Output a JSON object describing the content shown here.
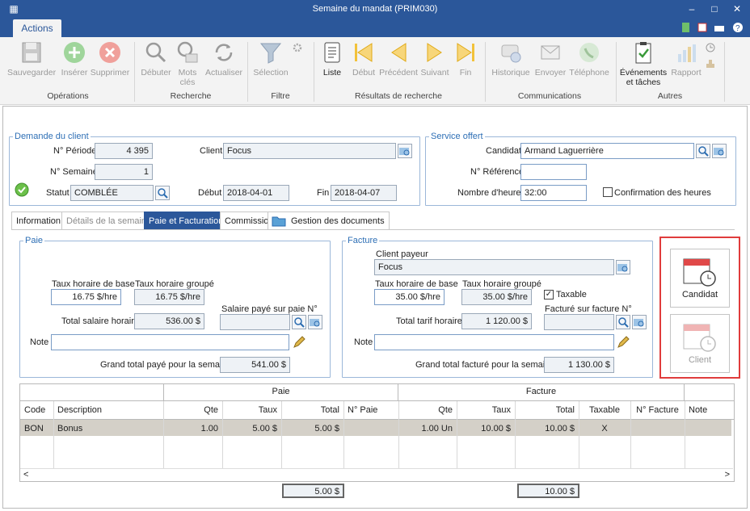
{
  "window": {
    "title": "Semaine du mandat (PRIM030)"
  },
  "ribbon": {
    "tab": "Actions",
    "groups": {
      "operations": {
        "label": "Opérations",
        "save": "Sauvegarder",
        "insert": "Insérer",
        "delete": "Supprimer"
      },
      "search": {
        "label": "Recherche",
        "start": "Débuter",
        "keywords_1": "Mots",
        "keywords_2": "clés",
        "refresh": "Actualiser"
      },
      "filter": {
        "label": "Filtre",
        "selection": "Sélection"
      },
      "results": {
        "label": "Résultats de recherche",
        "list": "Liste",
        "first": "Début",
        "previous": "Précédent",
        "next": "Suivant",
        "last": "Fin"
      },
      "communications": {
        "label": "Communications",
        "history": "Historique",
        "send": "Envoyer",
        "phone": "Téléphone"
      },
      "others": {
        "label": "Autres",
        "events_1": "Événements",
        "events_2": "et tâches",
        "report": "Rapport"
      }
    }
  },
  "client_request": {
    "legend": "Demande du client",
    "period_label": "N° Période",
    "period": "4 395",
    "week_label": "N° Semaine",
    "week": "1",
    "status_label": "Statut",
    "status": "COMBLÉE",
    "client_label": "Client",
    "client": "Focus",
    "start_label": "Début",
    "start": "2018-04-01",
    "end_label": "Fin",
    "end": "2018-04-07"
  },
  "service": {
    "legend": "Service offert",
    "candidate_label": "Candidat",
    "candidate": "Armand Laguerrière",
    "reference_label": "N° Référence",
    "reference": "",
    "hours_label": "Nombre d'heures",
    "hours": "32:00",
    "confirm_label": "Confirmation des heures"
  },
  "tabs": [
    "Information",
    "Détails de la semaine",
    "Paie et Facturation",
    "Commission",
    "Gestion des documents"
  ],
  "pay": {
    "legend": "Paie",
    "base_rate_label": "Taux horaire de base",
    "base_rate": "16.75 $/hre",
    "group_rate_label": "Taux horaire groupé",
    "group_rate": "16.75 $/hre",
    "total_label": "Total salaire horaire",
    "total": "536.00 $",
    "paid_on_label": "Salaire payé sur paie N°",
    "paid_on": "",
    "note_label": "Note",
    "note": "",
    "grand_total_label": "Grand total payé pour la semaine",
    "grand_total": "541.00 $"
  },
  "invoice": {
    "legend": "Facture",
    "payer_label": "Client payeur",
    "payer": "Focus",
    "base_rate_label": "Taux horaire de base",
    "base_rate": "35.00 $/hre",
    "group_rate_label": "Taux horaire groupé",
    "group_rate": "35.00 $/hre",
    "taxable_label": "Taxable",
    "total_label": "Total tarif horaire",
    "total": "1 120.00 $",
    "billed_on_label": "Facturé sur facture N°",
    "billed_on": "",
    "note_label": "Note",
    "note": "",
    "grand_total_label": "Grand total facturé pour la semaine",
    "grand_total": "1 130.00 $"
  },
  "side_tiles": {
    "candidate": "Candidat",
    "client": "Client",
    "highlight_color": "#e03c3c"
  },
  "table": {
    "group_pay": "Paie",
    "group_invoice": "Facture",
    "columns": [
      "Code",
      "Description",
      "Qte",
      "Taux",
      "Total",
      "N° Paie",
      "Qte",
      "Taux",
      "Total",
      "Taxable",
      "N° Facture",
      "Note"
    ],
    "rows": [
      [
        "BON",
        "Bonus",
        "1.00",
        "5.00 $",
        "5.00 $",
        "",
        "1.00 Un",
        "10.00 $",
        "10.00 $",
        "X",
        "",
        ""
      ]
    ],
    "pay_total": "5.00 $",
    "invoice_total": "10.00 $"
  }
}
